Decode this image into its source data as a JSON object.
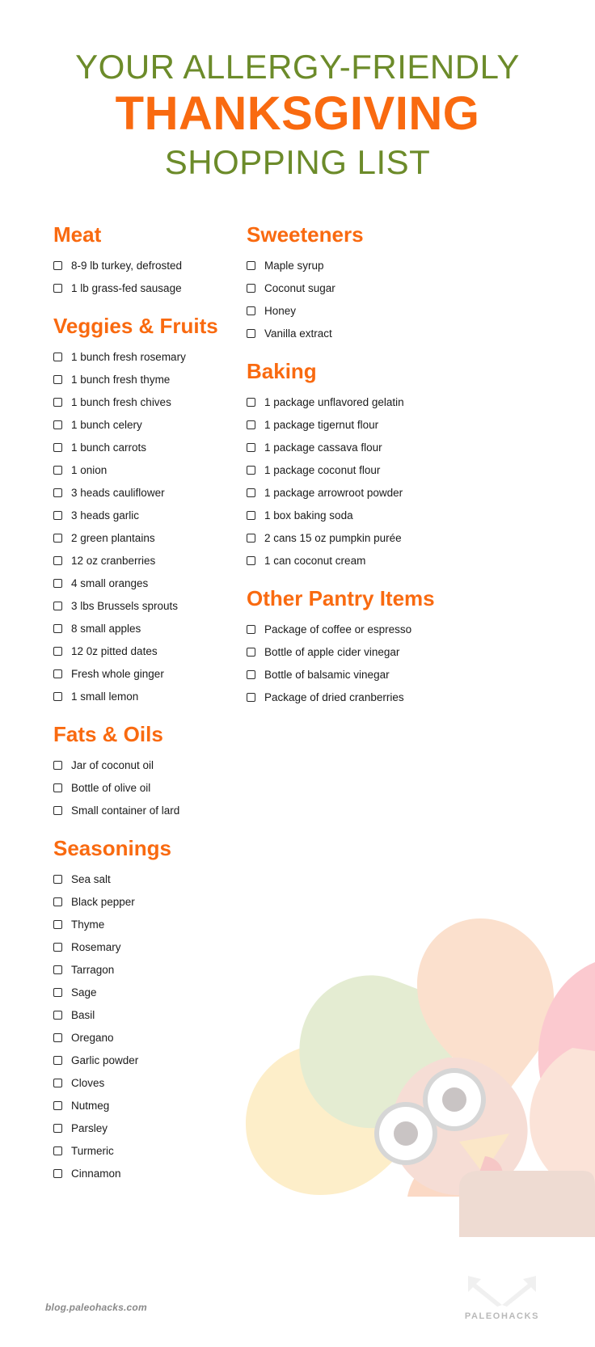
{
  "header": {
    "line1": "YOUR ALLERGY-FRIENDLY",
    "line2": "THANKSGIVING",
    "line3": "SHOPPING LIST",
    "colors": {
      "green": "#6c8b2a",
      "orange": "#f96a10"
    }
  },
  "left_column": [
    {
      "title": "Meat",
      "items": [
        "8-9 lb turkey, defrosted",
        "1 lb grass-fed sausage"
      ]
    },
    {
      "title": "Veggies & Fruits",
      "items": [
        "1 bunch fresh rosemary",
        "1 bunch fresh thyme",
        "1 bunch fresh chives",
        "1 bunch celery",
        "1 bunch carrots",
        "1 onion",
        "3 heads cauliflower",
        "3 heads garlic",
        "2 green plantains",
        "12 oz cranberries",
        "4 small oranges",
        "3 lbs Brussels sprouts",
        "8 small apples",
        "12 0z pitted dates",
        "Fresh whole ginger",
        "1 small lemon"
      ]
    },
    {
      "title": "Fats & Oils",
      "items": [
        "Jar of coconut oil",
        "Bottle of olive oil",
        "Small container of lard"
      ]
    },
    {
      "title": "Seasonings",
      "items": [
        "Sea salt",
        "Black pepper",
        "Thyme",
        "Rosemary",
        "Tarragon",
        "Sage",
        "Basil",
        "Oregano",
        "Garlic powder",
        "Cloves",
        "Nutmeg",
        "Parsley",
        "Turmeric",
        "Cinnamon"
      ]
    }
  ],
  "right_column": [
    {
      "title": "Sweeteners",
      "items": [
        "Maple syrup",
        "Coconut sugar",
        "Honey",
        "Vanilla extract"
      ]
    },
    {
      "title": "Baking",
      "items": [
        "1 package unflavored gelatin",
        "1 package tigernut flour",
        "1 package cassava flour",
        "1 package coconut flour",
        "1 package arrowroot powder",
        "1 box baking soda",
        "2 cans 15 oz pumpkin purée",
        "1 can coconut cream"
      ]
    },
    {
      "title": "Other Pantry Items",
      "items": [
        "Package of coffee or espresso",
        "Bottle of apple cider vinegar",
        "Bottle of balsamic vinegar",
        "Package of dried cranberries"
      ]
    }
  ],
  "footer": {
    "url": "blog.paleohacks.com",
    "brand": "PALEOHACKS"
  }
}
